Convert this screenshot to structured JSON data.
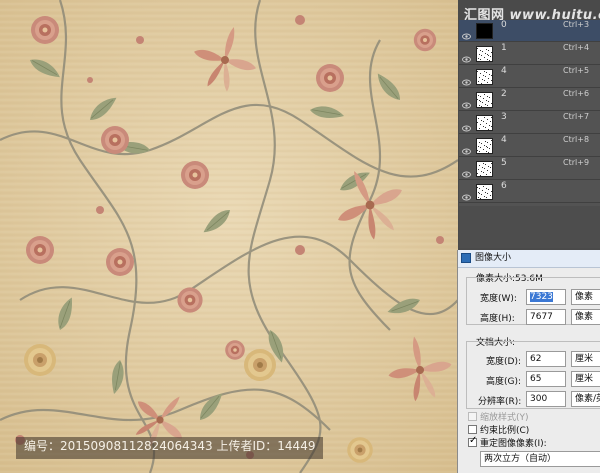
{
  "watermark": {
    "brand": "汇图网",
    "site": "www.huitu.com"
  },
  "caption": "编号：20150908112824064343 上传者ID：14449",
  "layers_panel": {
    "layers": [
      {
        "name": "0",
        "shortcut": "Ctrl+3",
        "selected": true
      },
      {
        "name": "1",
        "shortcut": "Ctrl+4",
        "selected": false
      },
      {
        "name": "4",
        "shortcut": "Ctrl+5",
        "selected": false
      },
      {
        "name": "2",
        "shortcut": "Ctrl+6",
        "selected": false
      },
      {
        "name": "3",
        "shortcut": "Ctrl+7",
        "selected": false
      },
      {
        "name": "4",
        "shortcut": "Ctrl+8",
        "selected": false
      },
      {
        "name": "5",
        "shortcut": "Ctrl+9",
        "selected": false
      },
      {
        "name": "6",
        "shortcut": "",
        "selected": false
      }
    ]
  },
  "image_size_dialog": {
    "title": "图像大小",
    "pixel_dimensions": {
      "label": "像素大小:53.6M",
      "width_label": "宽度(W):",
      "width_value": "7323",
      "width_unit": "像素",
      "height_label": "高度(H):",
      "height_value": "7677",
      "height_unit": "像素"
    },
    "document_size": {
      "label": "文档大小:",
      "width_label": "宽度(D):",
      "width_value": "62",
      "width_unit": "厘米",
      "height_label": "高度(G):",
      "height_value": "65",
      "height_unit": "厘米",
      "resolution_label": "分辨率(R):",
      "resolution_value": "300",
      "resolution_unit": "像素/英寸"
    },
    "options": {
      "scale_styles": {
        "label": "缩放样式(Y)",
        "checked": false,
        "enabled": false
      },
      "constrain": {
        "label": "约束比例(C)",
        "checked": false,
        "enabled": true
      },
      "resample": {
        "label": "重定图像像素(I):",
        "checked": true,
        "enabled": true
      }
    },
    "resample_method": "两次立方（自动）"
  },
  "colors": {
    "panel_bg": "#535353",
    "selected_layer": "#3d4d66",
    "dialog_bg": "#ececec",
    "canvas_base": "#e3cfa6"
  }
}
